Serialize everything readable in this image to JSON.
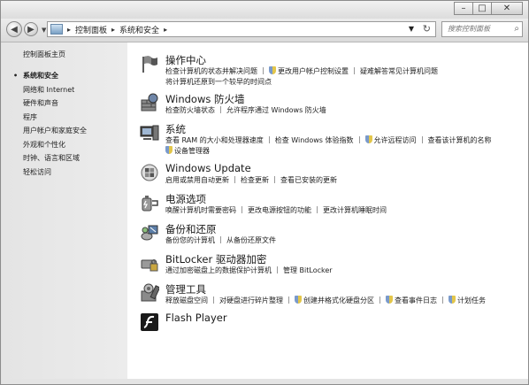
{
  "window": {
    "minimize": "–",
    "maximize": "□",
    "close": "✕"
  },
  "nav": {
    "back": "◀",
    "forward": "▶",
    "breadcrumb": [
      "控制面板",
      "系统和安全"
    ],
    "search_placeholder": "搜索控制面板",
    "refresh": "↻"
  },
  "sidebar": {
    "home": "控制面板主页",
    "items": [
      {
        "label": "系统和安全",
        "selected": true
      },
      {
        "label": "网络和 Internet"
      },
      {
        "label": "硬件和声音"
      },
      {
        "label": "程序"
      },
      {
        "label": "用户帐户和家庭安全"
      },
      {
        "label": "外观和个性化"
      },
      {
        "label": "时钟、语言和区域"
      },
      {
        "label": "轻松访问"
      }
    ]
  },
  "categories": [
    {
      "title": "操作中心",
      "icon": "flag-icon",
      "links": [
        [
          "检查计算机的状态并解决问题",
          "|",
          "!更改用户帐户控制设置",
          "|",
          "疑难解答常见计算机问题"
        ],
        [
          "将计算机还原到一个较早的时间点"
        ]
      ]
    },
    {
      "title": "Windows 防火墙",
      "icon": "firewall-icon",
      "links": [
        [
          "检查防火墙状态",
          "|",
          "允许程序通过 Windows 防火墙"
        ]
      ]
    },
    {
      "title": "系统",
      "icon": "computer-icon",
      "links": [
        [
          "查看 RAM 的大小和处理器速度",
          "|",
          "检查 Windows 体验指数",
          "|",
          "!允许远程访问",
          "|",
          "查看该计算机的名称"
        ],
        [
          "!设备管理器"
        ]
      ]
    },
    {
      "title": "Windows Update",
      "icon": "windows-update-icon",
      "links": [
        [
          "启用或禁用自动更新",
          "|",
          "检查更新",
          "|",
          "查看已安装的更新"
        ]
      ]
    },
    {
      "title": "电源选项",
      "icon": "power-icon",
      "links": [
        [
          "唤醒计算机时需要密码",
          "|",
          "更改电源按钮的功能",
          "|",
          "更改计算机睡眠时间"
        ]
      ]
    },
    {
      "title": "备份和还原",
      "icon": "backup-icon",
      "links": [
        [
          "备份您的计算机",
          "|",
          "从备份还原文件"
        ]
      ]
    },
    {
      "title": "BitLocker 驱动器加密",
      "icon": "bitlocker-icon",
      "links": [
        [
          "通过加密磁盘上的数据保护计算机",
          "|",
          "管理 BitLocker"
        ]
      ]
    },
    {
      "title": "管理工具",
      "icon": "admin-tools-icon",
      "links": [
        [
          "释放磁盘空间",
          "|",
          "对硬盘进行碎片整理",
          "|",
          "!创建并格式化硬盘分区",
          "|",
          "!查看事件日志",
          "|",
          "!计划任务"
        ]
      ]
    },
    {
      "title": "Flash Player",
      "icon": "flash-icon",
      "links": []
    }
  ]
}
